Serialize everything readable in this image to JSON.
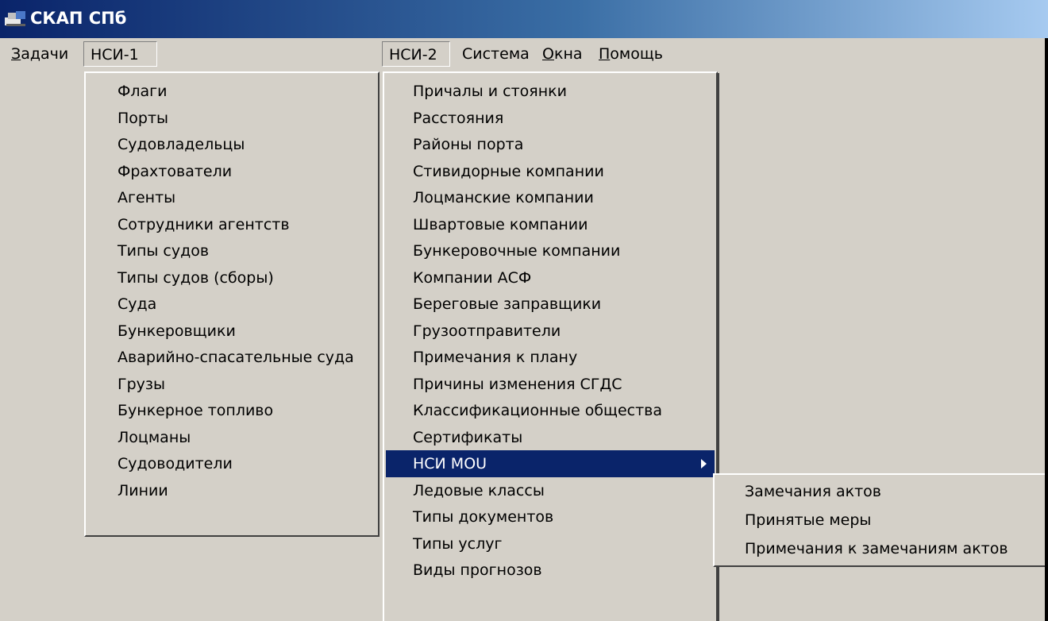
{
  "window": {
    "title": "СКАП СПб"
  },
  "menubar": {
    "items": [
      {
        "id": "tasks",
        "label": "Задачи",
        "accel": "З",
        "rest": "адачи"
      },
      {
        "id": "nsi1",
        "label": "НСИ-1"
      },
      {
        "id": "nsi2",
        "label": "НСИ-2"
      },
      {
        "id": "system",
        "label": "Система"
      },
      {
        "id": "windows",
        "label": "Окна",
        "accel": "О",
        "rest": "кна"
      },
      {
        "id": "help",
        "label": "Помощь",
        "accel": "П",
        "rest": "омощь"
      }
    ]
  },
  "menu_nsi1": {
    "items": [
      "Флаги",
      "Порты",
      "Судовладельцы",
      "Фрахтователи",
      "Агенты",
      "Сотрудники агентств",
      "Типы судов",
      "Типы судов (сборы)",
      "Суда",
      "Бункеровщики",
      "Аварийно-спасательные суда",
      "Грузы",
      "Бункерное топливо",
      "Лоцманы",
      "Судоводители",
      "Линии"
    ]
  },
  "menu_nsi2": {
    "items": [
      "Причалы и стоянки",
      "Расстояния",
      "Районы порта",
      "Стивидорные компании",
      "Лоцманские компании",
      "Швартовые компании",
      "Бункеровочные компании",
      "Компании АСФ",
      "Береговые заправщики",
      "Грузоотправители",
      "Примечания к плану",
      "Причины изменения СГДС",
      "Классификационные общества",
      "Сертификаты",
      "НСИ MOU",
      "Ледовые классы",
      "Типы документов",
      "Типы услуг",
      "Виды прогнозов"
    ],
    "highlighted": "НСИ MOU"
  },
  "submenu_mou": {
    "items": [
      "Замечания актов",
      "Принятые меры",
      "Примечания к замечаниям актов"
    ]
  },
  "colors": {
    "titlebar": "#0a246a",
    "menu_bg": "#d4d0c8",
    "highlight": "#0a246a"
  }
}
